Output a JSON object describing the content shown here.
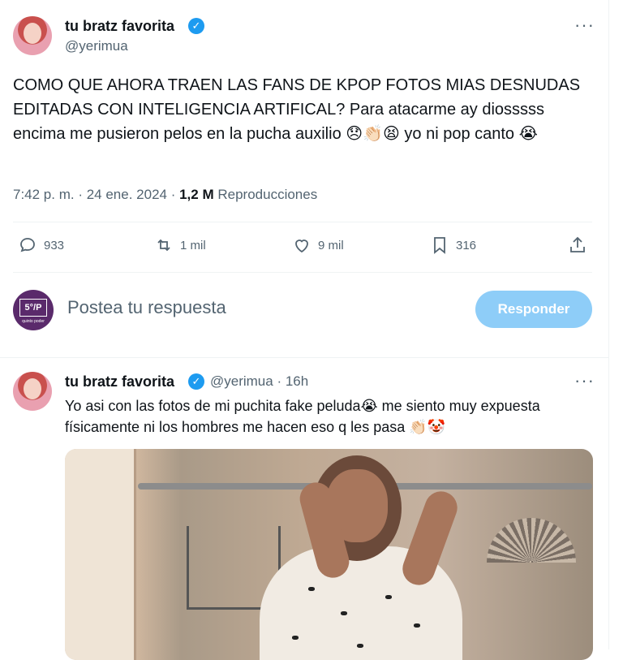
{
  "tweet": {
    "display_name": "tu bratz favorita",
    "handle": "@yerimua",
    "more": "···",
    "text": "COMO QUE AHORA TRAEN LAS FANS DE KPOP FOTOS MIAS DESNUDAS EDITADAS CON INTELIGENCIA ARTIFICAL? Para atacarme ay diosssss encima me pusieron pelos en la pucha auxilio 😞👏🏻😫 yo ni pop canto 😭",
    "time": "7:42 p. m.",
    "date": "24 ene. 2024",
    "views_count": "1,2 M",
    "views_label": "Reproducciones"
  },
  "actions": {
    "replies": "933",
    "retweets": "1 mil",
    "likes": "9 mil",
    "bookmarks": "316"
  },
  "composer": {
    "avatar_text": "5°/P",
    "avatar_subtext": "quinto poder",
    "placeholder": "Postea tu respuesta",
    "button_label": "Responder"
  },
  "reply": {
    "display_name": "tu bratz favorita",
    "handle": "@yerimua",
    "time_ago": "16h",
    "more": "···",
    "text": "Yo asi con las fotos de mi puchita fake peluda😭 me siento muy expuesta físicamente ni los hombres me hacen eso q les pasa 👏🏻🤡"
  },
  "colors": {
    "accent": "#1d9bf0",
    "button_disabled": "#8ecdf8",
    "muted": "#536471",
    "text": "#0f1419"
  }
}
